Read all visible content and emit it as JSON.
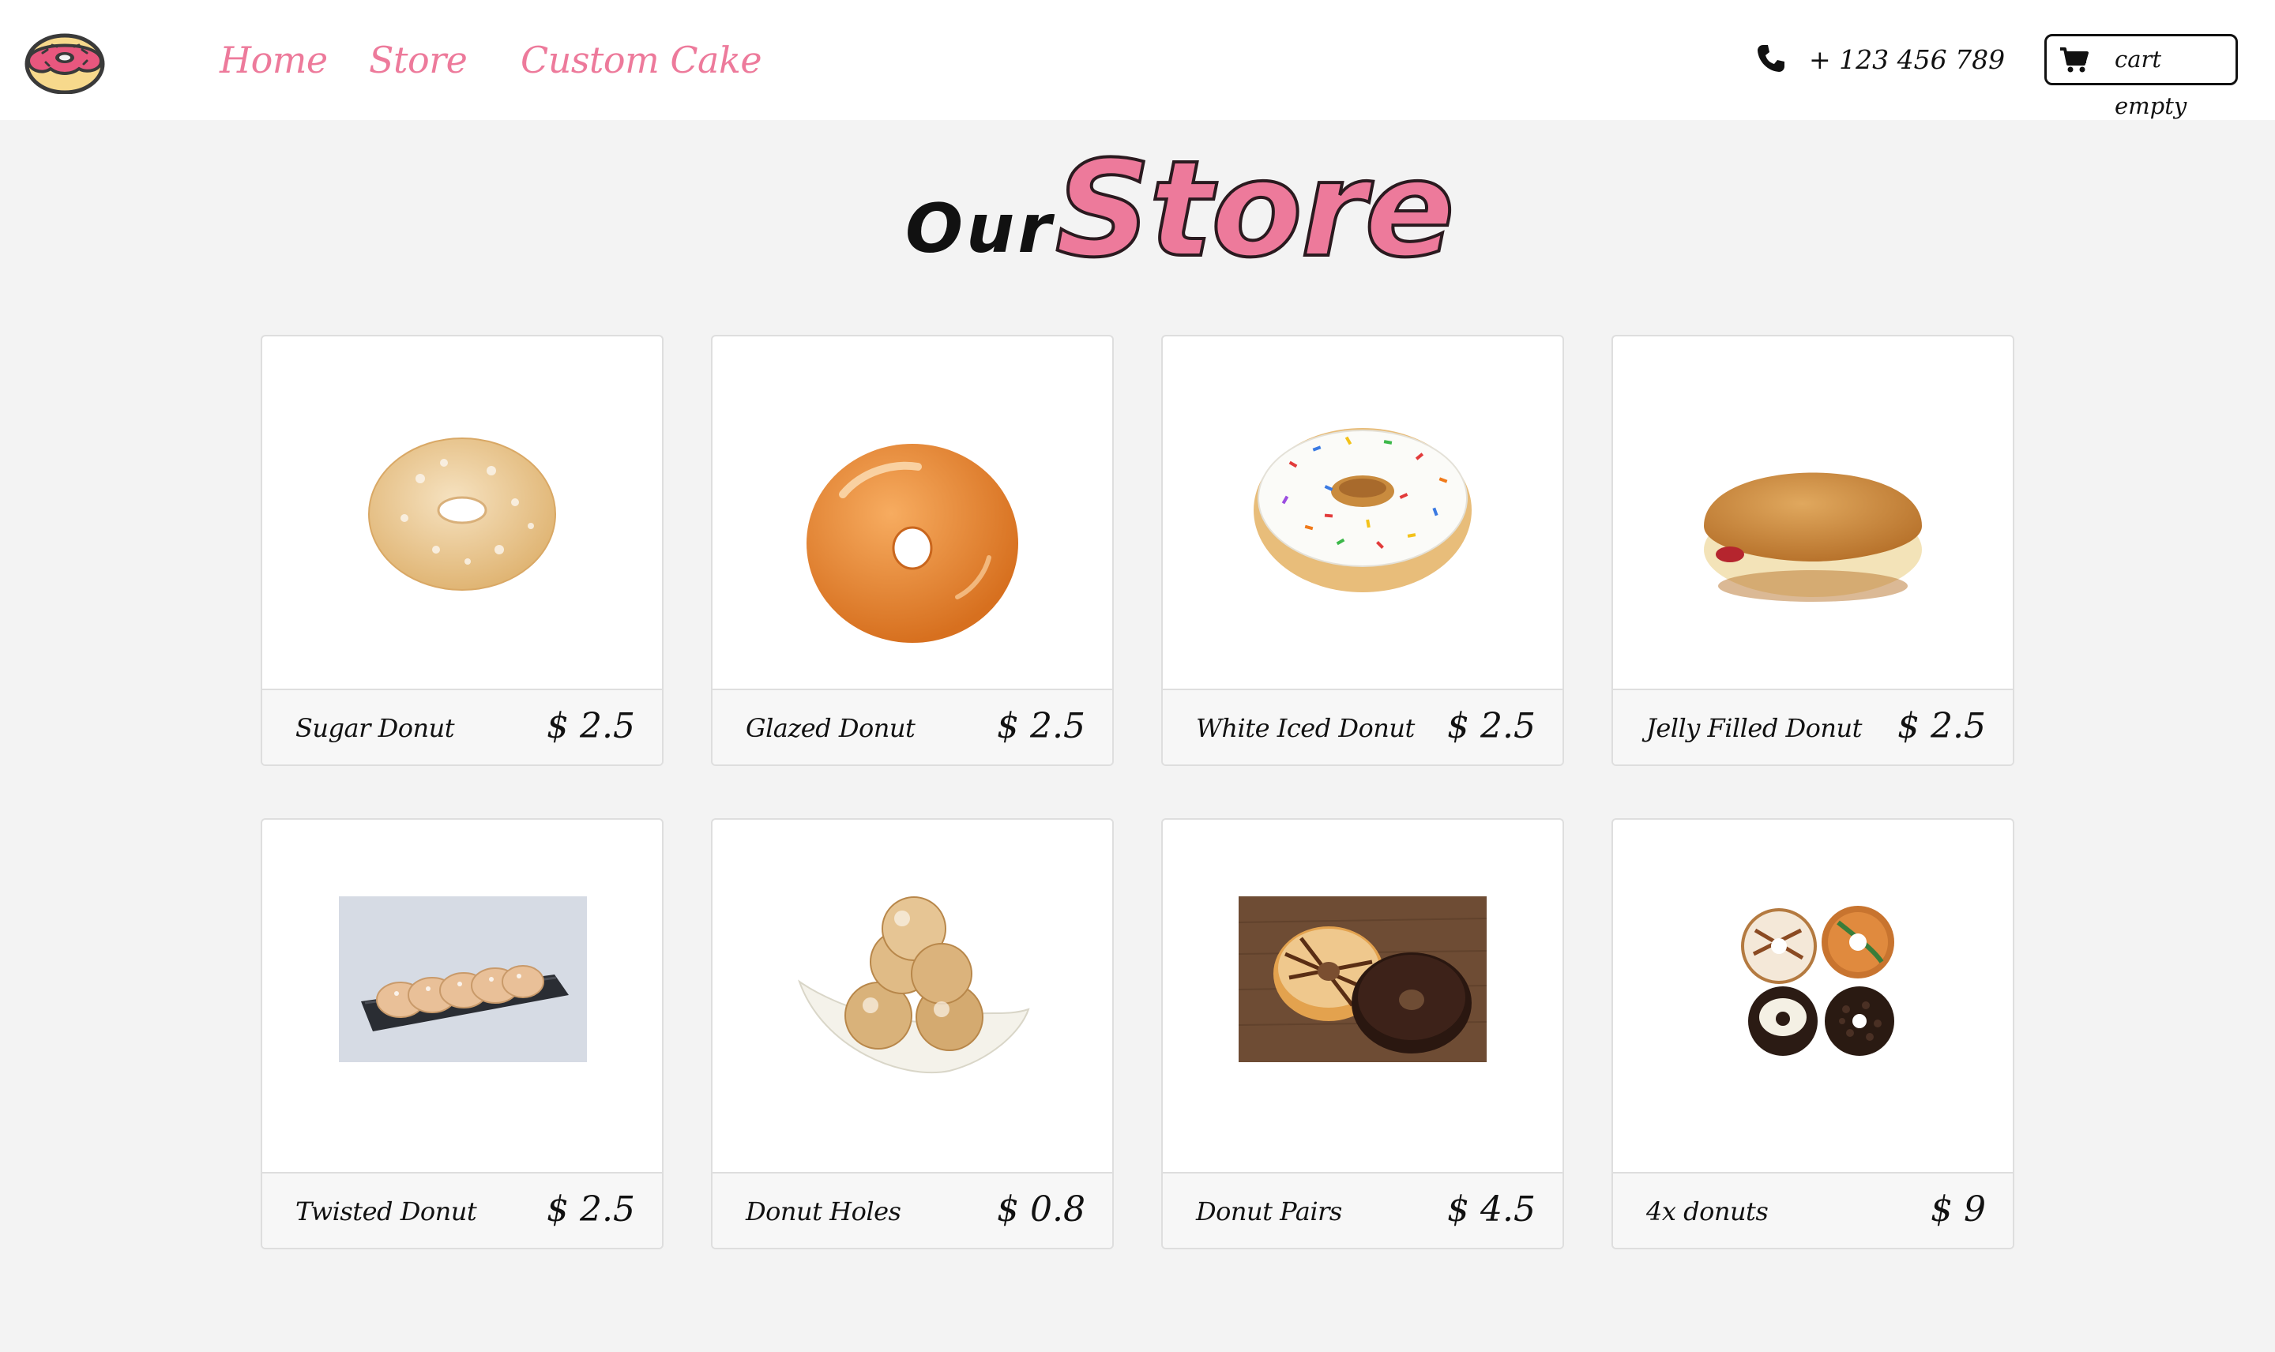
{
  "nav": {
    "links": [
      "Home",
      "Store",
      "Custom Cake"
    ],
    "phone": "+ 123 456 789",
    "cart": "cart empty"
  },
  "heading": {
    "part1": "Our",
    "part2": "Store"
  },
  "products": [
    {
      "name": "Sugar Donut",
      "price": "$ 2.5"
    },
    {
      "name": "Glazed Donut",
      "price": "$ 2.5"
    },
    {
      "name": "White Iced Donut",
      "price": "$ 2.5"
    },
    {
      "name": "Jelly Filled Donut",
      "price": "$ 2.5"
    },
    {
      "name": "Twisted Donut",
      "price": "$ 2.5"
    },
    {
      "name": "Donut Holes",
      "price": "$ 0.8"
    },
    {
      "name": "Donut Pairs",
      "price": "$ 4.5"
    },
    {
      "name": "4x donuts",
      "price": "$ 9"
    }
  ],
  "colors": {
    "accent": "#ed7a9b",
    "background": "#f3f3f3",
    "text": "#111111"
  }
}
